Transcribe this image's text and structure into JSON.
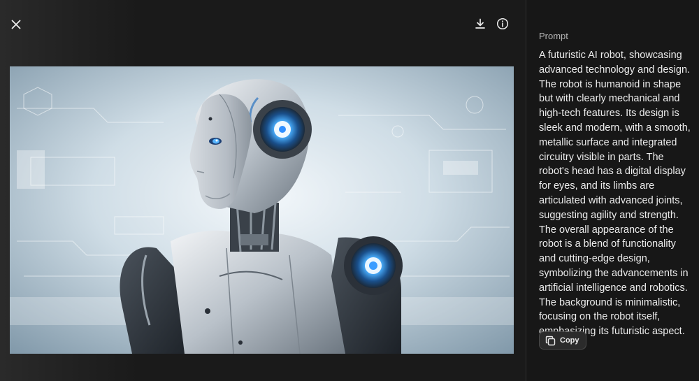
{
  "toolbar": {
    "close_icon": "close-icon",
    "download_icon": "download-icon",
    "info_icon": "info-icon"
  },
  "image": {
    "subject_icon": "robot-image"
  },
  "side_panel": {
    "label": "Prompt",
    "prompt": "A futuristic AI robot, showcasing advanced technology and design. The robot is humanoid in shape but with clearly mechanical and high-tech features. Its design is sleek and modern, with a smooth, metallic surface and integrated circuitry visible in parts. The robot's head has a digital display for eyes, and its limbs are articulated with advanced joints, suggesting agility and strength. The overall appearance of the robot is a blend of functionality and cutting-edge design, symbolizing the advancements in artificial intelligence and robotics. The background is minimalistic, focusing on the robot itself, emphasizing its futuristic aspect.",
    "copy_label": "Copy",
    "copy_icon": "copy-icon"
  },
  "colors": {
    "background": "#171717",
    "text": "#ececec",
    "muted": "#b4b4b4",
    "accent_glow": "#3aa0ff"
  }
}
